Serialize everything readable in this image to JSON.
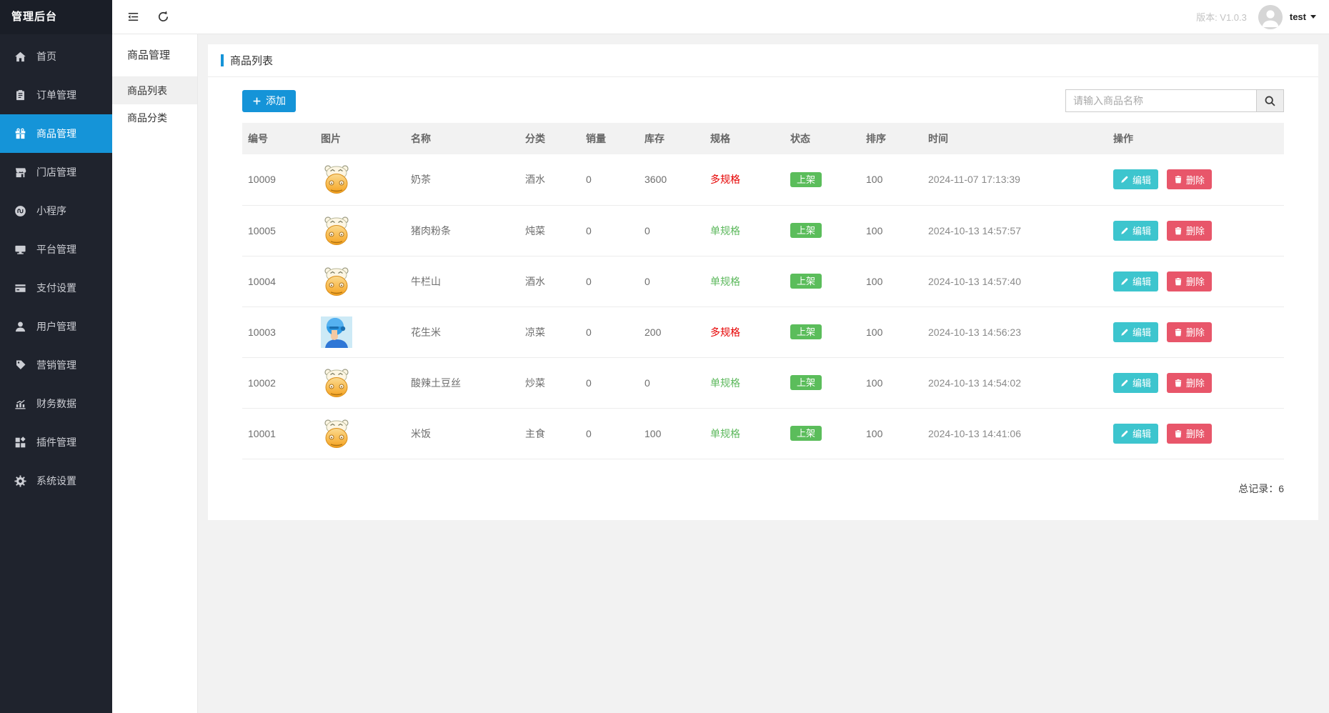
{
  "app": {
    "logo": "管理后台",
    "version_label": "版本: V1.0.3",
    "user": "test"
  },
  "colors": {
    "accent_blue": "#1594d8",
    "sidebar_bg": "#1f232d",
    "status_green": "#5bbd5b",
    "spec_red": "#e60000",
    "spec_green": "#5cb85c",
    "edit_teal": "#3dc5ce",
    "delete_red": "#e8566a"
  },
  "icons": [
    "collapse-menu-icon",
    "refresh-icon",
    "avatar-icon",
    "caret-down-icon",
    "home-icon",
    "order-icon",
    "product-icon",
    "store-icon",
    "miniprogram-icon",
    "platform-icon",
    "payment-icon",
    "user-icon",
    "marketing-icon",
    "finance-icon",
    "plugin-icon",
    "settings-icon",
    "plus-icon",
    "search-icon",
    "pencil-icon",
    "trash-icon"
  ],
  "sidebar": {
    "items": [
      {
        "label": "首页",
        "active": false
      },
      {
        "label": "订单管理",
        "active": false
      },
      {
        "label": "商品管理",
        "active": true
      },
      {
        "label": "门店管理",
        "active": false
      },
      {
        "label": "小程序",
        "active": false
      },
      {
        "label": "平台管理",
        "active": false
      },
      {
        "label": "支付设置",
        "active": false
      },
      {
        "label": "用户管理",
        "active": false
      },
      {
        "label": "营销管理",
        "active": false
      },
      {
        "label": "财务数据",
        "active": false
      },
      {
        "label": "插件管理",
        "active": false
      },
      {
        "label": "系统设置",
        "active": false
      }
    ]
  },
  "submenu": {
    "title": "商品管理",
    "items": [
      {
        "label": "商品列表",
        "active": true
      },
      {
        "label": "商品分类",
        "active": false
      }
    ]
  },
  "page": {
    "title": "商品列表",
    "add_button": "添加",
    "search_placeholder": "请输入商品名称",
    "total_label": "总记录：6"
  },
  "table": {
    "headers": [
      "编号",
      "图片",
      "名称",
      "分类",
      "销量",
      "库存",
      "规格",
      "状态",
      "排序",
      "时间",
      "操作"
    ],
    "edit_label": "编辑",
    "delete_label": "删除",
    "rows": [
      {
        "id": "10009",
        "image": "hippo",
        "name": "奶茶",
        "category": "酒水",
        "sales": "0",
        "stock": "3600",
        "spec": "多规格",
        "spec_type": "multi",
        "status": "上架",
        "sort": "100",
        "time": "2024-11-07 17:13:39"
      },
      {
        "id": "10005",
        "image": "hippo",
        "name": "猪肉粉条",
        "category": "炖菜",
        "sales": "0",
        "stock": "0",
        "spec": "单规格",
        "spec_type": "single",
        "status": "上架",
        "sort": "100",
        "time": "2024-10-13 14:57:57"
      },
      {
        "id": "10004",
        "image": "hippo",
        "name": "牛栏山",
        "category": "酒水",
        "sales": "0",
        "stock": "0",
        "spec": "单规格",
        "spec_type": "single",
        "status": "上架",
        "sort": "100",
        "time": "2024-10-13 14:57:40"
      },
      {
        "id": "10003",
        "image": "courier",
        "name": "花生米",
        "category": "凉菜",
        "sales": "0",
        "stock": "200",
        "spec": "多规格",
        "spec_type": "multi",
        "status": "上架",
        "sort": "100",
        "time": "2024-10-13 14:56:23"
      },
      {
        "id": "10002",
        "image": "hippo",
        "name": "酸辣土豆丝",
        "category": "炒菜",
        "sales": "0",
        "stock": "0",
        "spec": "单规格",
        "spec_type": "single",
        "status": "上架",
        "sort": "100",
        "time": "2024-10-13 14:54:02"
      },
      {
        "id": "10001",
        "image": "hippo",
        "name": "米饭",
        "category": "主食",
        "sales": "0",
        "stock": "100",
        "spec": "单规格",
        "spec_type": "single",
        "status": "上架",
        "sort": "100",
        "time": "2024-10-13 14:41:06"
      }
    ]
  }
}
